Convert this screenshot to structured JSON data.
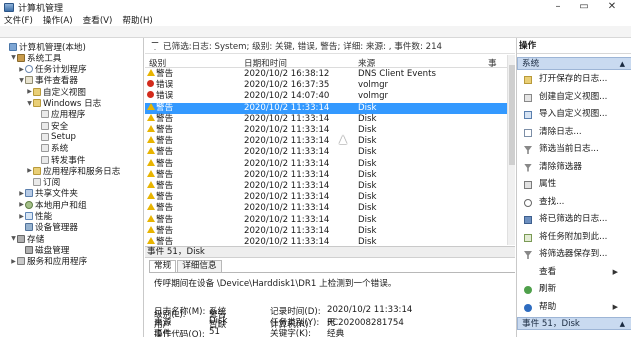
{
  "window": {
    "title": "计算机管理",
    "controls": [
      "minimize",
      "maximize",
      "close"
    ]
  },
  "menu": [
    "文件(F)",
    "操作(A)",
    "查看(V)",
    "帮助(H)"
  ],
  "tree": [
    {
      "label": "计算机管理(本地)",
      "level": 0,
      "expander": "",
      "icon": "computer-icon"
    },
    {
      "label": "系统工具",
      "level": 1,
      "expander": "▼",
      "icon": "tools-icon"
    },
    {
      "label": "任务计划程序",
      "level": 2,
      "expander": "▶",
      "icon": "clock-icon"
    },
    {
      "label": "事件查看器",
      "level": 2,
      "expander": "▼",
      "icon": "event-viewer-icon"
    },
    {
      "label": "自定义视图",
      "level": 3,
      "expander": "▶",
      "icon": "folder-icon"
    },
    {
      "label": "Windows 日志",
      "level": 3,
      "expander": "▼",
      "icon": "folder-icon"
    },
    {
      "label": "应用程序",
      "level": 4,
      "expander": "",
      "icon": "log-icon"
    },
    {
      "label": "安全",
      "level": 4,
      "expander": "",
      "icon": "log-icon"
    },
    {
      "label": "Setup",
      "level": 4,
      "expander": "",
      "icon": "log-icon"
    },
    {
      "label": "系统",
      "level": 4,
      "expander": "",
      "icon": "log-icon"
    },
    {
      "label": "转发事件",
      "level": 4,
      "expander": "",
      "icon": "log-icon"
    },
    {
      "label": "应用程序和服务日志",
      "level": 3,
      "expander": "▶",
      "icon": "folder-icon"
    },
    {
      "label": "订阅",
      "level": 3,
      "expander": "",
      "icon": "log-icon"
    },
    {
      "label": "共享文件夹",
      "level": 2,
      "expander": "▶",
      "icon": "share-icon"
    },
    {
      "label": "本地用户和组",
      "level": 2,
      "expander": "▶",
      "icon": "user-icon"
    },
    {
      "label": "性能",
      "level": 2,
      "expander": "▶",
      "icon": "performance-icon"
    },
    {
      "label": "设备管理器",
      "level": 2,
      "expander": "",
      "icon": "device-icon"
    },
    {
      "label": "存储",
      "level": 1,
      "expander": "▼",
      "icon": "storage-icon"
    },
    {
      "label": "磁盘管理",
      "level": 2,
      "expander": "",
      "icon": "disk-icon"
    },
    {
      "label": "服务和应用程序",
      "level": 1,
      "expander": "▶",
      "icon": "services-icon"
    }
  ],
  "filter_text": "已筛选:日志: System; 级别: 关键, 错误, 警告; 详细: 来源: , 事件数: 214",
  "columns": {
    "level": "级别",
    "datetime": "日期和时间",
    "source": "来源",
    "event": "事"
  },
  "events": [
    {
      "level": "警告",
      "type": "warning",
      "datetime": "2020/10/2 16:38:12",
      "source": "DNS Client Events",
      "selected": false
    },
    {
      "level": "错误",
      "type": "error",
      "datetime": "2020/10/2 16:37:35",
      "source": "volmgr",
      "selected": false
    },
    {
      "level": "错误",
      "type": "error",
      "datetime": "2020/10/2 14:07:40",
      "source": "volmgr",
      "selected": false
    },
    {
      "level": "警告",
      "type": "warning",
      "datetime": "2020/10/2 11:33:14",
      "source": "Disk",
      "selected": true
    },
    {
      "level": "警告",
      "type": "warning",
      "datetime": "2020/10/2 11:33:14",
      "source": "Disk",
      "selected": false
    },
    {
      "level": "警告",
      "type": "warning",
      "datetime": "2020/10/2 11:33:14",
      "source": "Disk",
      "selected": false
    },
    {
      "level": "警告",
      "type": "warning",
      "datetime": "2020/10/2 11:33:14",
      "source": "Disk",
      "selected": false
    },
    {
      "level": "警告",
      "type": "warning",
      "datetime": "2020/10/2 11:33:14",
      "source": "Disk",
      "selected": false
    },
    {
      "level": "警告",
      "type": "warning",
      "datetime": "2020/10/2 11:33:14",
      "source": "Disk",
      "selected": false
    },
    {
      "level": "警告",
      "type": "warning",
      "datetime": "2020/10/2 11:33:14",
      "source": "Disk",
      "selected": false
    },
    {
      "level": "警告",
      "type": "warning",
      "datetime": "2020/10/2 11:33:14",
      "source": "Disk",
      "selected": false
    },
    {
      "level": "警告",
      "type": "warning",
      "datetime": "2020/10/2 11:33:14",
      "source": "Disk",
      "selected": false
    },
    {
      "level": "警告",
      "type": "warning",
      "datetime": "2020/10/2 11:33:14",
      "source": "Disk",
      "selected": false
    },
    {
      "level": "警告",
      "type": "warning",
      "datetime": "2020/10/2 11:33:14",
      "source": "Disk",
      "selected": false
    },
    {
      "level": "警告",
      "type": "warning",
      "datetime": "2020/10/2 11:33:14",
      "source": "Disk",
      "selected": false
    },
    {
      "level": "警告",
      "type": "warning",
      "datetime": "2020/10/2 11:33:14",
      "source": "Disk",
      "selected": false
    }
  ],
  "detail": {
    "title": "事件 51，Disk",
    "tabs": [
      "常规",
      "详细信息"
    ],
    "description": "传呼期间在设备 \\Device\\Harddisk1\\DR1 上检测到一个错误。",
    "left_labels": [
      "日志名称(M):",
      "来源",
      "事件",
      "级别(L):",
      "用户",
      "操作代码(O):"
    ],
    "left_values": [
      "系统",
      "Disk",
      "51",
      "警告",
      "暂缺"
    ],
    "right_labels": [
      "记录时间(D):",
      "任务类别(Y):",
      "关键字(K):",
      "计算机(R):"
    ],
    "right_values": [
      "2020/10/2 11:33:14",
      "无",
      "经典",
      "PC202008281754"
    ]
  },
  "actions": {
    "header": "操作",
    "section1": "系统",
    "items": [
      {
        "label": "打开保存的日志...",
        "icon": "open-log-icon",
        "submenu": false
      },
      {
        "label": "创建自定义视图...",
        "icon": "custom-view-icon",
        "submenu": false
      },
      {
        "label": "导入自定义视图...",
        "icon": "import-icon",
        "submenu": false
      },
      {
        "label": "清除日志...",
        "icon": "clear-log-icon",
        "submenu": false
      },
      {
        "label": "筛选当前日志...",
        "icon": "filter-icon",
        "submenu": false
      },
      {
        "label": "清除筛选器",
        "icon": "clear-filter-icon",
        "submenu": false
      },
      {
        "label": "属性",
        "icon": "properties-icon",
        "submenu": false
      },
      {
        "label": "查找...",
        "icon": "find-icon",
        "submenu": false
      },
      {
        "label": "将已筛选的日志...",
        "icon": "save-filtered-icon",
        "submenu": false
      },
      {
        "label": "将任务附加到此...",
        "icon": "attach-task-icon",
        "submenu": false
      },
      {
        "label": "将筛选器保存到...",
        "icon": "save-filter-icon",
        "submenu": false
      },
      {
        "label": "查看",
        "icon": "",
        "submenu": true
      },
      {
        "label": "刷新",
        "icon": "refresh-icon",
        "submenu": false
      },
      {
        "label": "帮助",
        "icon": "help-icon",
        "submenu": true
      }
    ],
    "section2": "事件 51，Disk"
  }
}
